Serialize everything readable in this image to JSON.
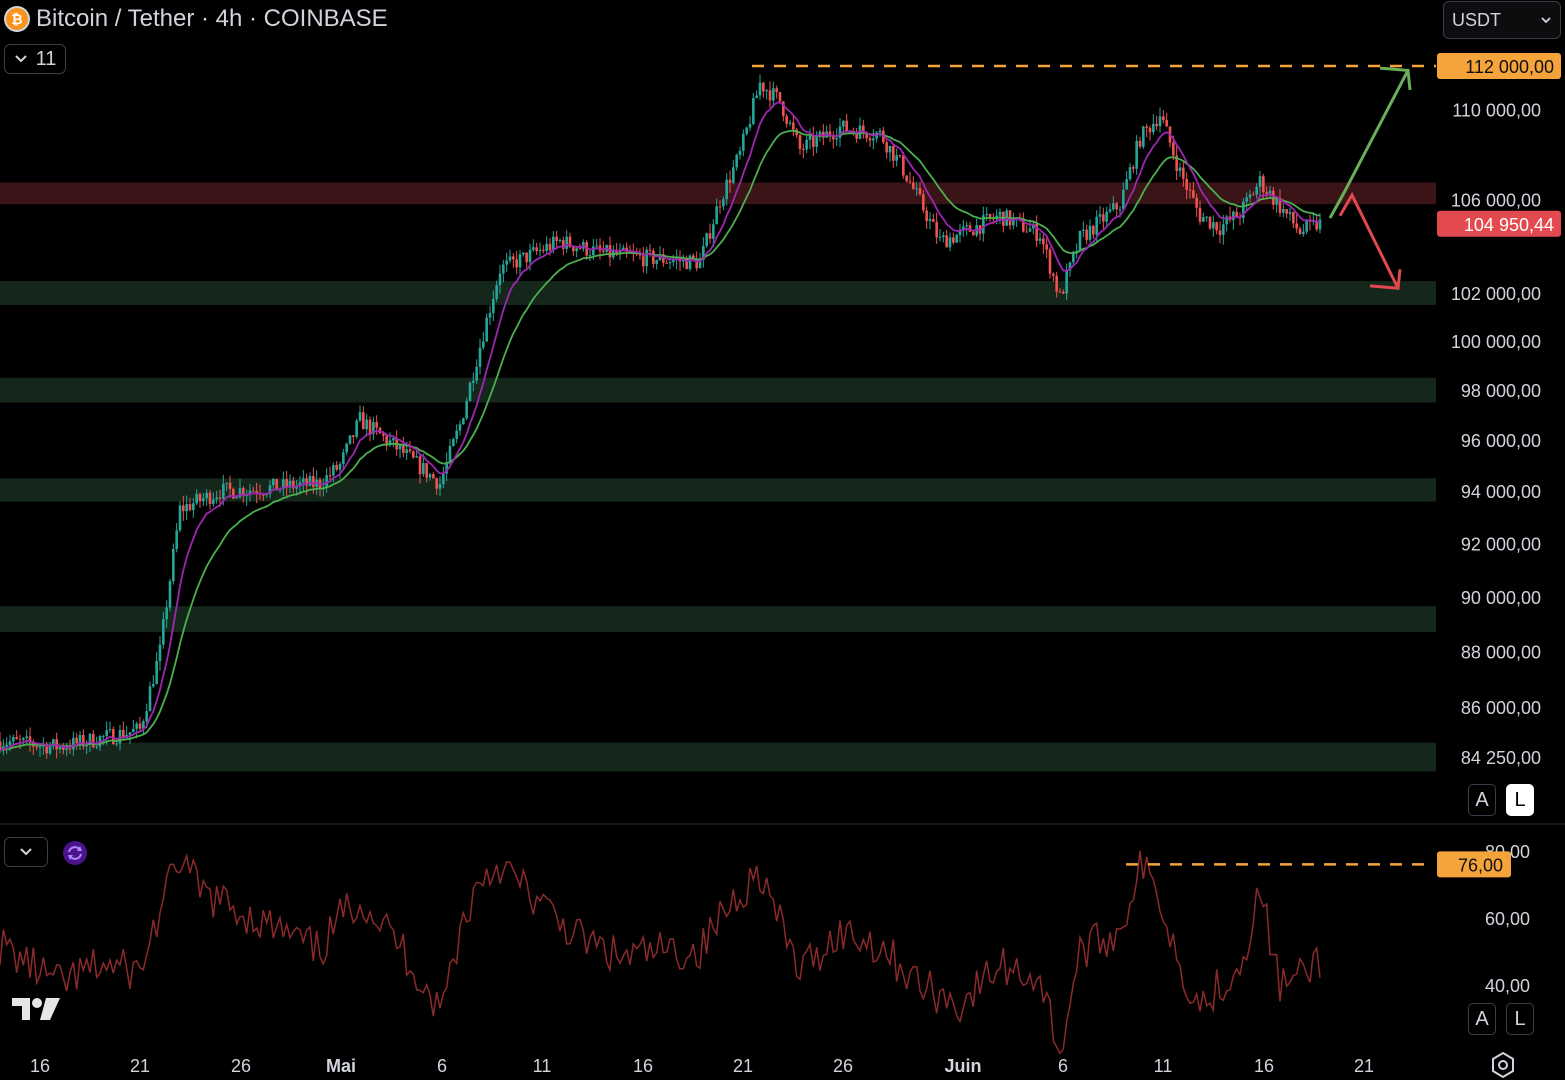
{
  "header": {
    "title": "Bitcoin / Tether · 4h · COINBASE",
    "logo_letter": "₿",
    "interval_count": "11",
    "currency": "USDT"
  },
  "scale_buttons": {
    "auto": "A",
    "log": "L"
  },
  "colors": {
    "background": "#000000",
    "up": "#26a69a",
    "down": "#ef5350",
    "ema_fast": "#9c27b0",
    "ema_slow": "#4caf50",
    "resistance_zone": "#3b1417",
    "support_zone": "#15271a",
    "target_line": "#f5a33b",
    "rsi_line": "#8b2a2a"
  },
  "chart_data": [
    {
      "type": "candlestick",
      "title": "Bitcoin / Tether · 4h · COINBASE",
      "ylim": [
        82800,
        113300
      ],
      "y_ticks": [
        110000,
        106000,
        102000,
        100000,
        98000,
        96000,
        94000,
        92000,
        90000,
        88000,
        86000,
        84250
      ],
      "y_tick_labels": [
        "110 000,00",
        "106 000,00",
        "102 000,00",
        "100 000,00",
        "98 000,00",
        "96 000,00",
        "94 000,00",
        "92 000,00",
        "90 000,00",
        "88 000,00",
        "86 000,00",
        "84 250,00"
      ],
      "x_ticks": [
        "16",
        "21",
        "26",
        "Mai",
        "6",
        "11",
        "16",
        "21",
        "26",
        "Juin",
        "6",
        "11",
        "16",
        "21"
      ],
      "price_path": [
        [
          "04-14",
          84800
        ],
        [
          "04-17",
          84600
        ],
        [
          "04-19",
          84900
        ],
        [
          "04-21",
          85200
        ],
        [
          "04-22",
          88000
        ],
        [
          "04-23",
          93300
        ],
        [
          "04-25",
          94000
        ],
        [
          "04-27",
          94100
        ],
        [
          "04-30",
          94300
        ],
        [
          "05-01",
          95000
        ],
        [
          "05-02",
          96800
        ],
        [
          "05-04",
          95600
        ],
        [
          "05-06",
          94300
        ],
        [
          "05-07",
          96600
        ],
        [
          "05-08",
          99800
        ],
        [
          "05-09",
          103000
        ],
        [
          "05-12",
          104200
        ],
        [
          "05-14",
          103700
        ],
        [
          "05-16",
          103500
        ],
        [
          "05-19",
          103300
        ],
        [
          "05-20",
          106000
        ],
        [
          "05-21",
          108000
        ],
        [
          "05-22",
          111200
        ],
        [
          "05-23",
          110400
        ],
        [
          "05-24",
          108200
        ],
        [
          "05-26",
          109200
        ],
        [
          "05-28",
          108900
        ],
        [
          "05-29",
          107600
        ],
        [
          "05-31",
          104200
        ],
        [
          "06-01",
          104500
        ],
        [
          "06-03",
          105300
        ],
        [
          "06-05",
          104500
        ],
        [
          "06-06",
          101800
        ],
        [
          "06-07",
          104300
        ],
        [
          "06-09",
          105800
        ],
        [
          "06-10",
          108700
        ],
        [
          "06-11",
          109800
        ],
        [
          "06-12",
          107200
        ],
        [
          "06-13",
          105300
        ],
        [
          "06-14",
          104800
        ],
        [
          "06-15",
          105400
        ],
        [
          "06-16",
          106800
        ],
        [
          "06-17",
          105700
        ],
        [
          "06-18",
          104600
        ],
        [
          "06-19",
          104950
        ]
      ],
      "current_price": 104950.44,
      "current_price_label": "104 950,44",
      "target_level": 112000,
      "target_label": "112 000,00",
      "resistance_zone": [
        105800,
        106750
      ],
      "support_zones": [
        [
          101500,
          102500
        ],
        [
          97500,
          98500
        ],
        [
          93600,
          94500
        ],
        [
          88700,
          89650
        ],
        [
          83750,
          84750
        ]
      ],
      "moving_averages": 2,
      "scenarios": [
        "up",
        "down"
      ]
    },
    {
      "type": "line",
      "ylim": [
        17,
        86
      ],
      "y_ticks": [
        80,
        60,
        40
      ],
      "y_tick_labels": [
        "80,00",
        "60,00",
        "40,00"
      ],
      "rsi_path": [
        [
          "04-14",
          52
        ],
        [
          "04-17",
          40
        ],
        [
          "04-19",
          46
        ],
        [
          "04-21",
          44
        ],
        [
          "04-22",
          62
        ],
        [
          "04-23",
          78
        ],
        [
          "04-24",
          68
        ],
        [
          "04-26",
          62
        ],
        [
          "04-28",
          56
        ],
        [
          "04-30",
          50
        ],
        [
          "05-01",
          60
        ],
        [
          "05-02",
          66
        ],
        [
          "05-04",
          52
        ],
        [
          "05-06",
          32
        ],
        [
          "05-07",
          56
        ],
        [
          "05-08",
          72
        ],
        [
          "05-09",
          76
        ],
        [
          "05-11",
          64
        ],
        [
          "05-13",
          54
        ],
        [
          "05-15",
          48
        ],
        [
          "05-17",
          50
        ],
        [
          "05-19",
          50
        ],
        [
          "05-20",
          60
        ],
        [
          "05-21",
          68
        ],
        [
          "05-22",
          74
        ],
        [
          "05-23",
          58
        ],
        [
          "05-24",
          44
        ],
        [
          "05-26",
          56
        ],
        [
          "05-28",
          52
        ],
        [
          "05-30",
          40
        ],
        [
          "06-01",
          34
        ],
        [
          "06-03",
          46
        ],
        [
          "06-05",
          42
        ],
        [
          "06-06",
          20
        ],
        [
          "06-07",
          50
        ],
        [
          "06-09",
          56
        ],
        [
          "06-10",
          76
        ],
        [
          "06-11",
          66
        ],
        [
          "06-12",
          46
        ],
        [
          "06-13",
          34
        ],
        [
          "06-14",
          40
        ],
        [
          "06-15",
          46
        ],
        [
          "06-16",
          68
        ],
        [
          "06-17",
          40
        ],
        [
          "06-18",
          42
        ],
        [
          "06-19",
          48
        ]
      ],
      "level": 76,
      "level_label": "76,00"
    }
  ]
}
